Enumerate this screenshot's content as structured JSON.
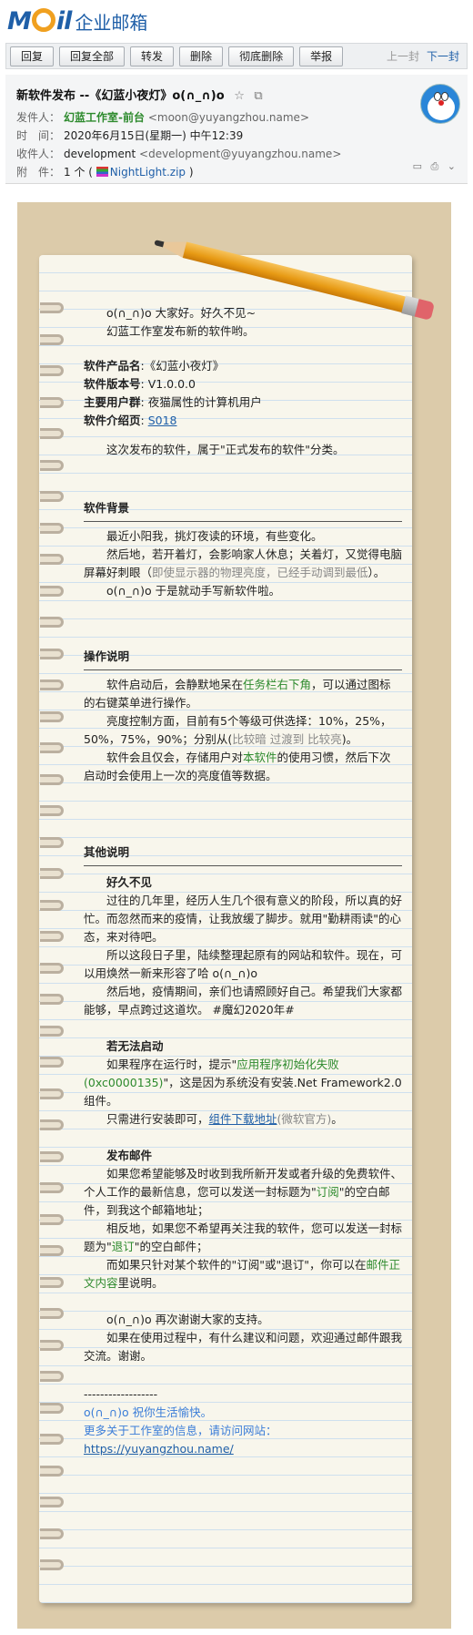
{
  "logo": {
    "mail_text": "Mail",
    "product_name": "企业邮箱"
  },
  "toolbar": {
    "buttons": [
      "回复",
      "回复全部",
      "转发",
      "删除",
      "彻底删除",
      "举报"
    ],
    "prev_label": "上一封",
    "next_label": "下一封"
  },
  "header": {
    "subject": "新软件发布 --《幻蓝小夜灯》o(∩_∩)o",
    "from_label": "发件人：",
    "from_name": "幻蓝工作室-前台",
    "from_addr": "<moon@yuyangzhou.name>",
    "time_label": "时　间：",
    "time_value": "2020年6月15日(星期一) 中午12:39",
    "to_label": "收件人：",
    "to_name": "development",
    "to_addr": "<development@yuyangzhou.name>",
    "attach_label": "附　件：",
    "attach_count": "1 个 (",
    "attach_file": "NightLight.zip",
    "attach_close": ")"
  },
  "letter": {
    "greeting1": "o(∩_∩)o  大家好。好久不见~",
    "greeting2": "幻蓝工作室发布新的软件哟。",
    "info": [
      {
        "k": "软件产品名",
        "v": ":《幻蓝小夜灯》"
      },
      {
        "k": "软件版本号",
        "v": ": V1.0.0.0"
      },
      {
        "k": "主要用户群",
        "v": ": 夜猫属性的计算机用户"
      },
      {
        "k": "软件介绍页",
        "v": ": "
      }
    ],
    "intro_link": "S018",
    "category": "这次发布的软件，属于\"正式发布的软件\"分类。",
    "bg_title": "软件背景",
    "bg1": "最近小阳我，挑灯夜读的环境，有些变化。",
    "bg2a": "然后地，若开着灯，会影响家人休息；关着灯，又觉得电脑屏幕好刺眼（",
    "bg2b": "即使显示器的物理亮度，已经手动调到最低",
    "bg2c": "）。",
    "bg3": "o(∩_∩)o 于是就动手写新软件啦。",
    "op_title": "操作说明",
    "op1a": "软件启动后，会静默地呆在",
    "op1b": "任务栏右下角",
    "op1c": "，可以通过图标的右键菜单进行操作。",
    "op2a": "亮度控制方面，目前有5个等级可供选择：10%，25%，50%，75%，90%；分别从(",
    "op2b": "比较暗 过渡到 比较亮",
    "op2c": ")。",
    "op3a": "软件会且仅会，存储用户对",
    "op3b": "本软件",
    "op3c": "的使用习惯，然后下次启动时会使用上一次的亮度值等数据。",
    "other_title": "其他说明",
    "long_title": "好久不见",
    "long1": "过往的几年里，经历人生几个很有意义的阶段，所以真的好忙。而忽然而来的疫情，让我放缓了脚步。就用\"勤耕雨读\"的心态，来对待吧。",
    "long2": "所以这段日子里，陆续整理起原有的网站和软件。现在，可以用焕然一新来形容了哈 o(∩_∩)o",
    "long3": "然后地，疫情期间，亲们也请照顾好自己。希望我们大家都能够，早点跨过这道坎。 #魔幻2020年#",
    "fail_title": "若无法启动",
    "fail1a": "如果程序在运行时，提示\"",
    "fail1b": "应用程序初始化失败(0xc0000135)",
    "fail1c": "\"，这是因为系统没有安装.Net Framework2.0组件。",
    "fail2a": "只需进行安装即可，",
    "fail2b": "组件下载地址",
    "fail2c": "(微软官方)",
    "fail2d": "。",
    "pub_title": "发布邮件",
    "pub1a": "如果您希望能够及时收到我所新开发或者升级的免费软件、个人工作的最新信息，您可以发送一封标题为\"",
    "pub1b": "订阅",
    "pub1c": "\"的空白邮件，到我这个邮箱地址；",
    "pub2a": "相反地，如果您不希望再关注我的软件，您可以发送一封标题为\"",
    "pub2b": "退订",
    "pub2c": "\"的空白邮件；",
    "pub3a": "而如果只针对某个软件的\"订阅\"或\"退订\"，你可以在",
    "pub3b": "邮件正文内容",
    "pub3c": "里说明。",
    "thanks1": "o(∩_∩)o 再次谢谢大家的支持。",
    "thanks2": "如果在使用过程中，有什么建议和问题，欢迎通过邮件跟我交流。谢谢。",
    "sig_line": "------------------",
    "sig1": "o(∩_∩)o  祝你生活愉快。",
    "sig2": "更多关于工作室的信息，请访问网站：",
    "sig_url": "https://yuyangzhou.name/"
  },
  "colors": {
    "accent": "#1f5fa8",
    "green": "#2d8a2d",
    "paper": "#f8f6ec",
    "frame": "#dccbaa"
  },
  "icons": [
    "star-icon",
    "popout-icon",
    "zip-file-icon",
    "avatar",
    "pencil"
  ]
}
